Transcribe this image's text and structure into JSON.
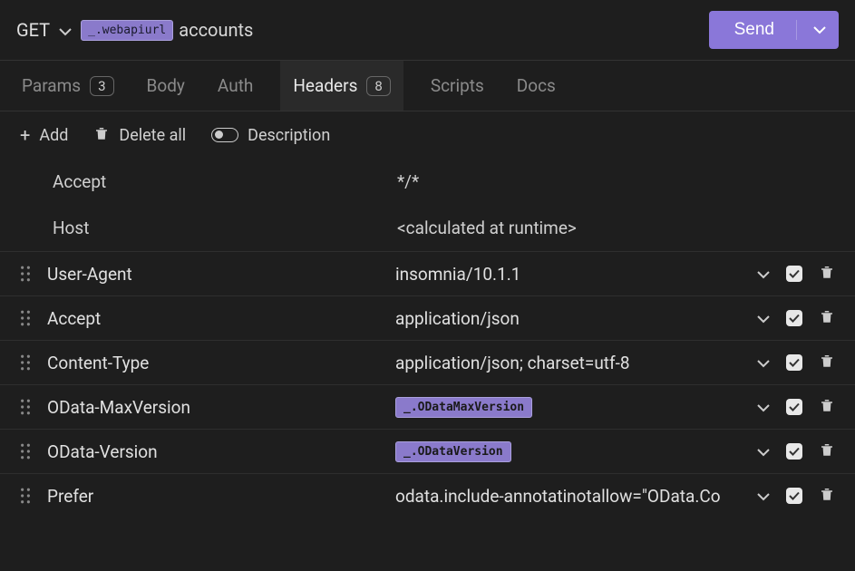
{
  "request": {
    "method": "GET",
    "url_pill": "_.webapiurl",
    "url_suffix": "accounts",
    "send_label": "Send"
  },
  "tabs": {
    "params": {
      "label": "Params",
      "badge": "3"
    },
    "body": {
      "label": "Body"
    },
    "auth": {
      "label": "Auth"
    },
    "headers": {
      "label": "Headers",
      "badge": "8"
    },
    "scripts": {
      "label": "Scripts"
    },
    "docs": {
      "label": "Docs"
    }
  },
  "toolbar": {
    "add": "Add",
    "delete_all": "Delete all",
    "description": "Description"
  },
  "static_headers": [
    {
      "name": "Accept",
      "value": "*/*"
    },
    {
      "name": "Host",
      "value": "<calculated at runtime>"
    }
  ],
  "headers": [
    {
      "name": "User-Agent",
      "type": "text",
      "value": "insomnia/10.1.1"
    },
    {
      "name": "Accept",
      "type": "text",
      "value": "application/json"
    },
    {
      "name": "Content-Type",
      "type": "text",
      "value": "application/json; charset=utf-8"
    },
    {
      "name": "OData-MaxVersion",
      "type": "pill",
      "value": "_.ODataMaxVersion"
    },
    {
      "name": "OData-Version",
      "type": "pill",
      "value": "_.ODataVersion"
    },
    {
      "name": "Prefer",
      "type": "text",
      "value": "odata.include-annotatinotallow=\"OData.Co"
    }
  ]
}
